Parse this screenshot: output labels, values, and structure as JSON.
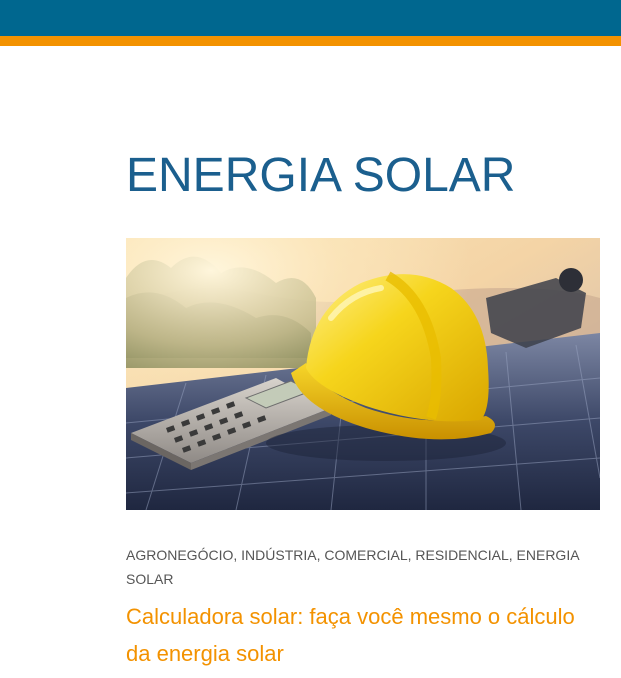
{
  "header": {
    "bar_color": "#00678f",
    "accent_color": "#f39200"
  },
  "page": {
    "title": "ENERGIA SOLAR"
  },
  "post": {
    "image_icon": "hard-hat-calculator-solar-panel-photo",
    "categories": [
      {
        "label": "AGRONEGÓCIO"
      },
      {
        "label": "INDÚSTRIA"
      },
      {
        "label": "COMERCIAL"
      },
      {
        "label": "RESIDENCIAL"
      },
      {
        "label": "ENERGIA SOLAR"
      }
    ],
    "separator": ",",
    "title": "Calculadora solar: faça você mesmo o cálculo da energia solar"
  }
}
